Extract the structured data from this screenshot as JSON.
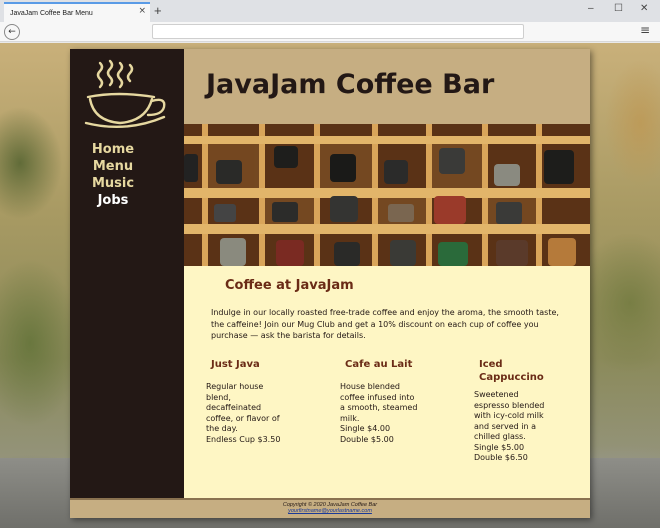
{
  "browser": {
    "tab_title": "JavaJam Coffee Bar Menu",
    "tab_close": "×",
    "new_tab": "+",
    "minimize": "–",
    "maximize": "☐",
    "close": "✕",
    "back": "←",
    "url": "",
    "menu": "≡"
  },
  "site": {
    "title": "JavaJam Coffee Bar",
    "nav": [
      "Home",
      "Menu",
      "Music",
      "Jobs"
    ],
    "heading": "Coffee at JavaJam",
    "intro": "Indulge in our locally roasted free-trade coffee and enjoy the aroma, the smooth taste, the caffeine! Join our Mug Club and get a 10% discount on each cup of coffee you purchase — ask the barista for details.",
    "menu": [
      {
        "name": "Just Java",
        "lines": [
          "Regular house",
          "blend,",
          "decaffeinated",
          "coffee, or flavor of",
          "the day.",
          "Endless Cup $3.50"
        ]
      },
      {
        "name": "Cafe au Lait",
        "lines": [
          "House blended",
          "coffee infused into",
          "a smooth, steamed",
          "milk.",
          "Single $4.00",
          "Double $5.00"
        ]
      },
      {
        "name": "Iced Cappuccino",
        "lines": [
          "Sweetened",
          "espresso blended",
          "with icy-cold milk",
          "and served in a",
          "chilled glass.",
          "Single $5.00",
          "Double $6.50"
        ]
      }
    ],
    "footer": {
      "copyright": "Copyright © 2020 JavaJam Coffee Bar",
      "email": "yourfirstname@yourlastname.com"
    }
  },
  "colors": {
    "sidebar": "#231815",
    "header": "#c6ae82",
    "content_bg": "#fef6c4",
    "heading": "#6a2b16",
    "nav_text": "#e6d8a0"
  }
}
